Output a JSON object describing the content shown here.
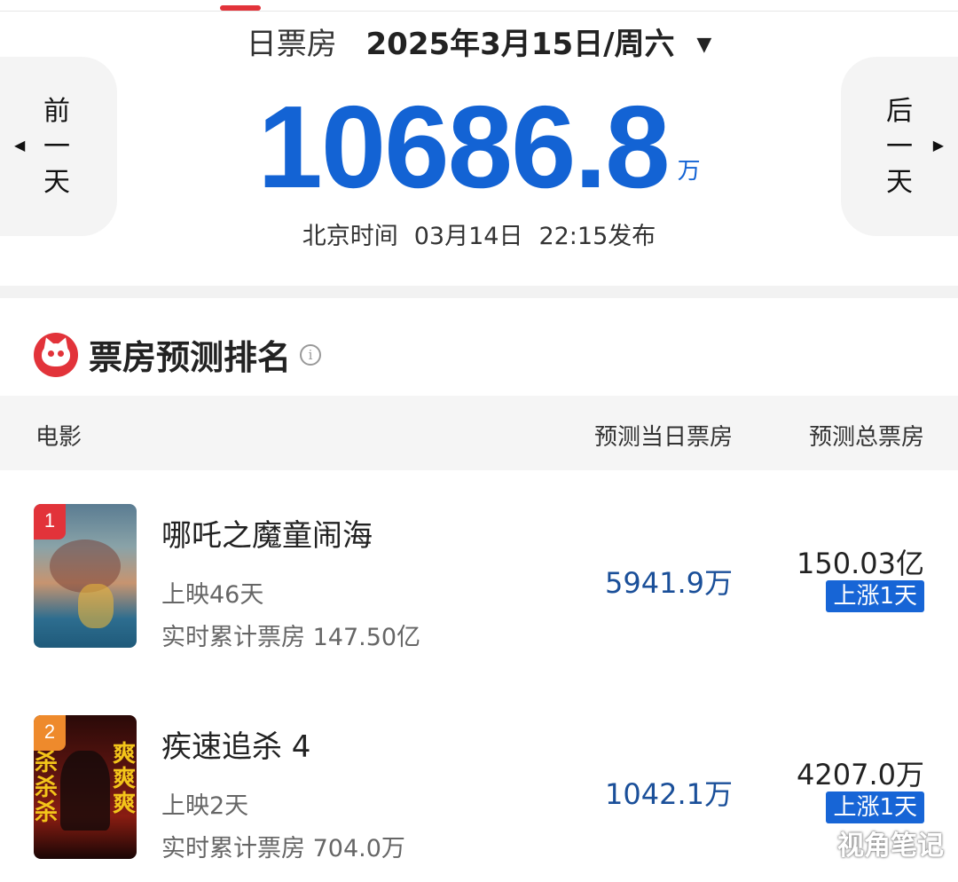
{
  "header": {
    "label": "日票房",
    "date": "2025年3月15日/周六",
    "caret": "▼"
  },
  "nav": {
    "prev": {
      "arrow": "◀",
      "c1": "前",
      "c2": "一",
      "c3": "天"
    },
    "next": {
      "arrow": "▶",
      "c1": "后",
      "c2": "一",
      "c3": "天"
    }
  },
  "total": {
    "value": "10686.8",
    "unit": "万"
  },
  "publish": {
    "prefix": "北京时间",
    "date": "03月14日",
    "time": "22:15发布"
  },
  "section": {
    "title": "票房预测排名",
    "info": "i"
  },
  "table": {
    "col_movie": "电影",
    "col_day": "预测当日票房",
    "col_total": "预测总票房",
    "rows": [
      {
        "rank": "1",
        "title": "哪吒之魔童闹海",
        "days": "上映46天",
        "cumulative": "实时累计票房 147.50亿",
        "pred_day": "5941.9万",
        "pred_total": "150.03亿",
        "badge": "上涨1天"
      },
      {
        "rank": "2",
        "title": "疾速追杀 4",
        "days": "上映2天",
        "cumulative": "实时累计票房 704.0万",
        "pred_day": "1042.1万",
        "pred_total": "4207.0万",
        "badge": "上涨1天",
        "poster_left": "杀杀杀",
        "poster_right": "爽爽爽"
      }
    ]
  },
  "watermark": "视角笔记",
  "colors": {
    "accent": "#1363d4",
    "brand_red": "#e2333a",
    "badge_blue": "#1765d6"
  }
}
